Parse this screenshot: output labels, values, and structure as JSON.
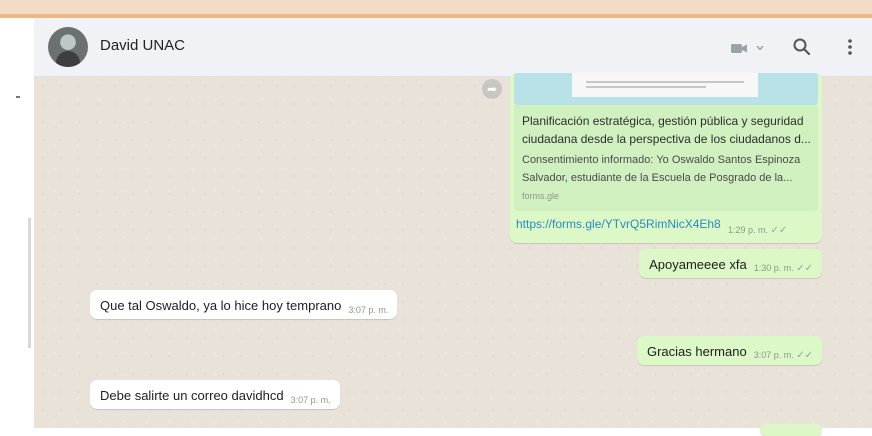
{
  "header": {
    "contact_name": "David UNAC",
    "icons": [
      "video-camera-icon",
      "chevron-down-icon",
      "search-icon",
      "menu-dots-icon"
    ]
  },
  "messages": [
    {
      "direction": "out",
      "type": "link",
      "preview_title": "Planificación estratégica, gestión pública y seguridad ciudadana desde la perspectiva de los ciudadanos d...",
      "preview_description": "Consentimiento informado: Yo Oswaldo Santos Espinoza Salvador, estudiante de la Escuela de Posgrado de la...",
      "preview_domain": "forms.gle",
      "text": "https://forms.gle/YTvrQ5RimNicX4Eh8",
      "time": "1:29 p. m."
    },
    {
      "direction": "out",
      "text": "Apoyameeee xfa",
      "time": "1:30 p. m."
    },
    {
      "direction": "in",
      "text": "Que tal Oswaldo, ya lo hice hoy temprano",
      "time": "3:07 p. m."
    },
    {
      "direction": "out",
      "text": "Gracias hermano",
      "time": "3:07 p. m."
    },
    {
      "direction": "in",
      "text": "Debe salirte un correo davidhcd",
      "time": "3:07 p. m."
    }
  ],
  "colors": {
    "outgoing_bubble": "#dcf8c6",
    "incoming_bubble": "#ffffff",
    "chat_background": "#e9e2d8",
    "link": "#2a8abf"
  }
}
